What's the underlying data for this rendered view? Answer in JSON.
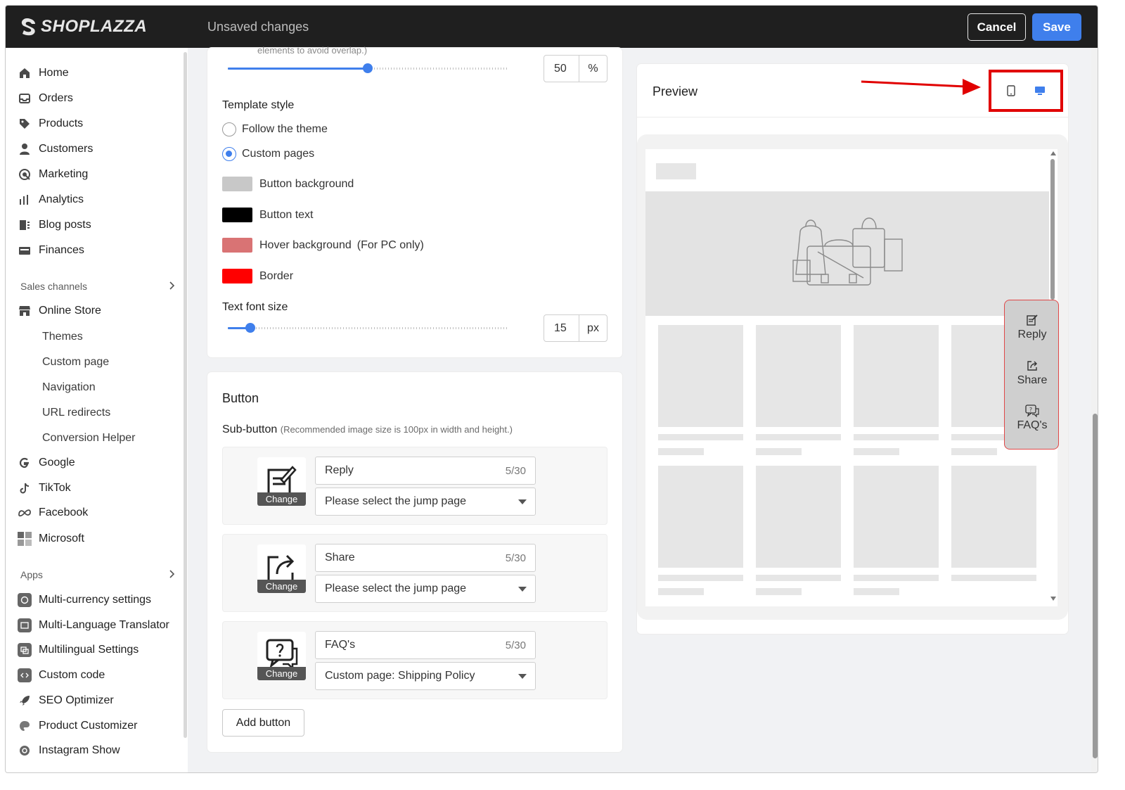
{
  "topbar": {
    "brand": "SHOPLAZZA",
    "status": "Unsaved changes",
    "cancel_label": "Cancel",
    "save_label": "Save",
    "save_color": "#3f7fec"
  },
  "sidebar": {
    "main_items": [
      {
        "label": "Home",
        "icon": "home-icon"
      },
      {
        "label": "Orders",
        "icon": "orders-icon"
      },
      {
        "label": "Products",
        "icon": "tag-icon"
      },
      {
        "label": "Customers",
        "icon": "person-icon"
      },
      {
        "label": "Marketing",
        "icon": "marketing-icon"
      },
      {
        "label": "Analytics",
        "icon": "bar-chart-icon"
      },
      {
        "label": "Blog posts",
        "icon": "blog-icon"
      },
      {
        "label": "Finances",
        "icon": "finance-icon"
      }
    ],
    "sales_channels_label": "Sales channels",
    "online_store_label": "Online Store",
    "online_store_sub": [
      "Themes",
      "Custom page",
      "Navigation",
      "URL redirects",
      "Conversion Helper"
    ],
    "channels": [
      {
        "label": "Google",
        "icon": "google-icon"
      },
      {
        "label": "TikTok",
        "icon": "tiktok-icon"
      },
      {
        "label": "Facebook",
        "icon": "meta-icon"
      },
      {
        "label": "Microsoft",
        "icon": "microsoft-icon"
      }
    ],
    "apps_label": "Apps",
    "apps": [
      {
        "label": "Multi-currency settings"
      },
      {
        "label": "Multi-Language Translator"
      },
      {
        "label": "Multilingual Settings"
      },
      {
        "label": "Custom code"
      },
      {
        "label": "SEO Optimizer"
      },
      {
        "label": "Product Customizer"
      },
      {
        "label": "Instagram Show"
      }
    ]
  },
  "settings": {
    "cut_text": "elements to avoid overlap.)",
    "position_slider": {
      "value": "50",
      "unit": "%",
      "fraction": 0.5
    },
    "template_style_label": "Template style",
    "template_options": [
      "Follow the theme",
      "Custom pages"
    ],
    "template_selected": "Custom pages",
    "colors": [
      {
        "label": "Button background",
        "color": "#c8c8c8"
      },
      {
        "label": "Button text",
        "color": "#000000"
      },
      {
        "label": "Hover background",
        "note": "(For PC only)",
        "color": "#d97374"
      },
      {
        "label": "Border",
        "color": "#ff0000"
      }
    ],
    "font_size_label": "Text font size",
    "font_slider": {
      "value": "15",
      "unit": "px",
      "fraction": 0.08
    }
  },
  "button_section": {
    "title": "Button",
    "sub_button_label": "Sub-button",
    "sub_button_hint": "(Recommended image size is 100px in width and height.)",
    "change_label": "Change",
    "items": [
      {
        "name": "Reply",
        "count": "5/30",
        "jump": "Please select the jump page",
        "icon": "reply-icon"
      },
      {
        "name": "Share",
        "count": "5/30",
        "jump": "Please select the jump page",
        "icon": "share-icon"
      },
      {
        "name": "FAQ's",
        "count": "5/30",
        "jump": "Custom page: Shipping Policy",
        "icon": "faq-icon"
      }
    ],
    "add_label": "Add button"
  },
  "preview": {
    "title": "Preview",
    "devices": [
      "mobile-icon",
      "desktop-icon"
    ],
    "active_device": "desktop-icon",
    "highlight_color": "#e10000",
    "float_buttons": [
      {
        "label": "Reply",
        "icon": "reply-icon"
      },
      {
        "label": "Share",
        "icon": "share-icon"
      },
      {
        "label": "FAQ's",
        "icon": "faq-icon"
      }
    ]
  }
}
